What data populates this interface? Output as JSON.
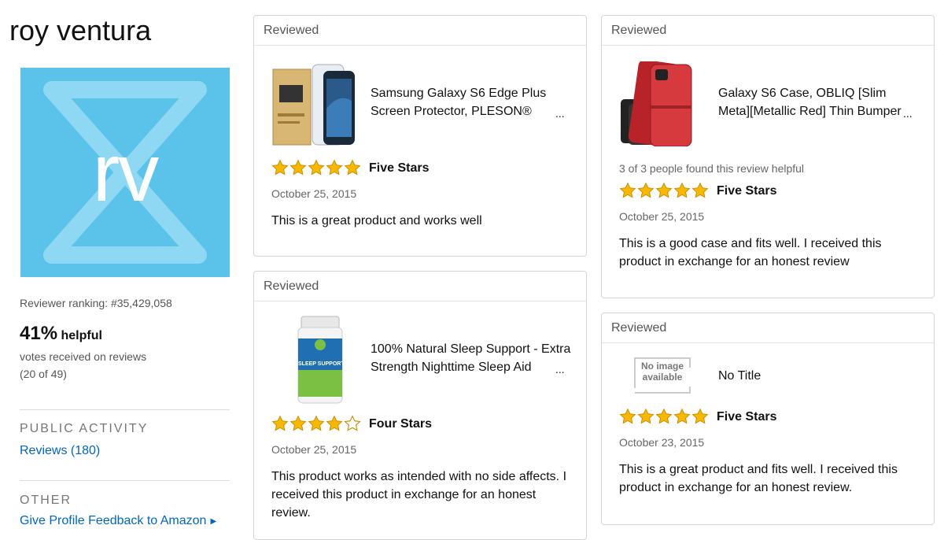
{
  "profile": {
    "name": "roy ventura",
    "avatar_initials": "rv",
    "ranking": "Reviewer ranking: #35,429,058",
    "helpful_pct": "41%",
    "helpful_word": "helpful",
    "votes_line": "votes received on reviews",
    "votes_count": "(20 of 49)"
  },
  "sections": {
    "public_activity": "PUBLIC ACTIVITY",
    "reviews_link": "Reviews (180)",
    "other": "OTHER",
    "feedback_link": "Give Profile Feedback to Amazon"
  },
  "colors": {
    "avatar_bg": "#5bc3ea",
    "star": "#f6b800",
    "link": "#0066c0"
  },
  "reviews": [
    {
      "header": "Reviewed",
      "product_line1": "Samsung Galaxy S6 Edge Plus",
      "product_line2": "Screen Protector, PLESON®",
      "ellipsis": "...",
      "rating": 5,
      "rating_title": "Five Stars",
      "date": "October 25, 2015",
      "body_line1": "This is a great product and works well",
      "thumbnail_icon": "screen-protector-product-image"
    },
    {
      "header": "Reviewed",
      "product_line1": "100% Natural Sleep Support - Extra",
      "product_line2": "Strength Nighttime Sleep Aid",
      "ellipsis": "...",
      "rating": 4,
      "rating_title": "Four Stars",
      "date": "October 25, 2015",
      "body_line1": "This product works as intended with no side affects. I",
      "body_line2": "received this product in exchange for an honest",
      "body_line3": "review.",
      "thumbnail_icon": "supplement-bottle-product-image",
      "thumbnail_text": "SLEEP SUPPORT"
    },
    {
      "header": "Reviewed",
      "product_line1": "Galaxy S6 Case, OBLIQ [Slim",
      "product_line2": "Meta][Metallic Red] Thin Bumper",
      "ellipsis": "...",
      "helpful_text": "3 of 3 people found this review helpful",
      "rating": 5,
      "rating_title": "Five Stars",
      "date": "October 25, 2015",
      "body_line1": "This is a good case and fits well. I received this",
      "body_line2": "product in exchange for an honest review",
      "thumbnail_icon": "phone-case-product-image"
    },
    {
      "header": "Reviewed",
      "product_title": "No Title",
      "no_image_line1": "No image",
      "no_image_line2": "available",
      "rating": 5,
      "rating_title": "Five Stars",
      "date": "October 23, 2015",
      "body_line1": "This is a great product and fits well. I received this",
      "body_line2": "product in exchange for an honest review.",
      "thumbnail_icon": "no-image-placeholder"
    }
  ]
}
